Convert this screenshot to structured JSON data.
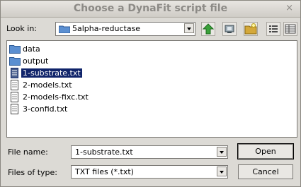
{
  "dialog": {
    "title": "Choose a DynaFit script file",
    "close_glyph": "×"
  },
  "look_in": {
    "label": "Look in:",
    "value": "5alpha-reductase"
  },
  "toolbar": {
    "icons": [
      "up-folder-icon",
      "home-icon",
      "new-folder-icon",
      "list-view-icon",
      "details-view-icon"
    ]
  },
  "files": [
    {
      "name": "data",
      "type": "folder"
    },
    {
      "name": "output",
      "type": "folder"
    },
    {
      "name": "1-substrate.txt",
      "type": "file",
      "selected": true
    },
    {
      "name": "2-models.txt",
      "type": "file"
    },
    {
      "name": "2-models-fixc.txt",
      "type": "file"
    },
    {
      "name": "3-confid.txt",
      "type": "file"
    }
  ],
  "file_name": {
    "label": "File name:",
    "value": "1-substrate.txt"
  },
  "file_type": {
    "label": "Files of type:",
    "value": "TXT files (*.txt)"
  },
  "buttons": {
    "open": "Open",
    "cancel": "Cancel"
  }
}
